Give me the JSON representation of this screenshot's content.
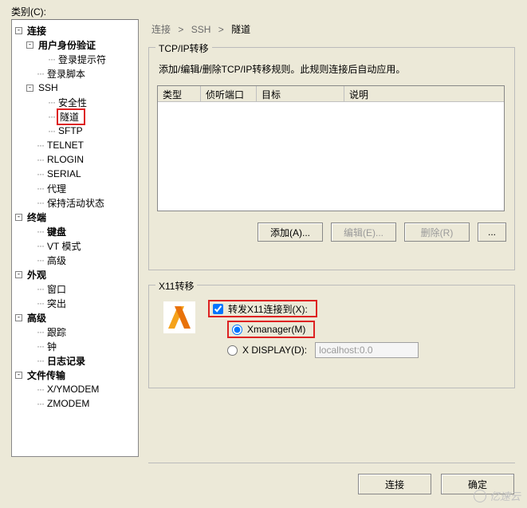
{
  "labels": {
    "category": "类别(C):"
  },
  "tree": {
    "connection": "连接",
    "auth": "用户身份验证",
    "login_prompt": "登录提示符",
    "login_script": "登录脚本",
    "ssh": "SSH",
    "security": "安全性",
    "tunnel": "隧道",
    "sftp": "SFTP",
    "telnet": "TELNET",
    "rlogin": "RLOGIN",
    "serial": "SERIAL",
    "proxy": "代理",
    "keepalive": "保持活动状态",
    "terminal": "终端",
    "keyboard": "键盘",
    "vtmode": "VT 模式",
    "advanced_t": "高级",
    "appearance": "外观",
    "window": "窗口",
    "highlight": "突出",
    "advanced": "高级",
    "trace": "跟踪",
    "bell": "钟",
    "logging": "日志记录",
    "filetransfer": "文件传输",
    "xymodem": "X/YMODEM",
    "zmodem": "ZMODEM"
  },
  "breadcrumb": {
    "a": "连接",
    "b": "SSH",
    "c": "隧道"
  },
  "tcp": {
    "legend": "TCP/IP转移",
    "instruction": "添加/编辑/删除TCP/IP转移规则。此规则连接后自动应用。",
    "col_type": "类型",
    "col_listen": "侦听端口",
    "col_target": "目标",
    "col_desc": "说明",
    "btn_add": "添加(A)...",
    "btn_edit": "编辑(E)...",
    "btn_remove": "删除(R)",
    "btn_more": "..."
  },
  "x11": {
    "legend": "X11转移",
    "forward": "转发X11连接到(X):",
    "xmanager": "Xmanager(M)",
    "xdisplay": "X DISPLAY(D):",
    "xdisplay_value": "localhost:0.0"
  },
  "footer": {
    "connect": "连接",
    "ok": "确定"
  },
  "watermark": "亿速云"
}
